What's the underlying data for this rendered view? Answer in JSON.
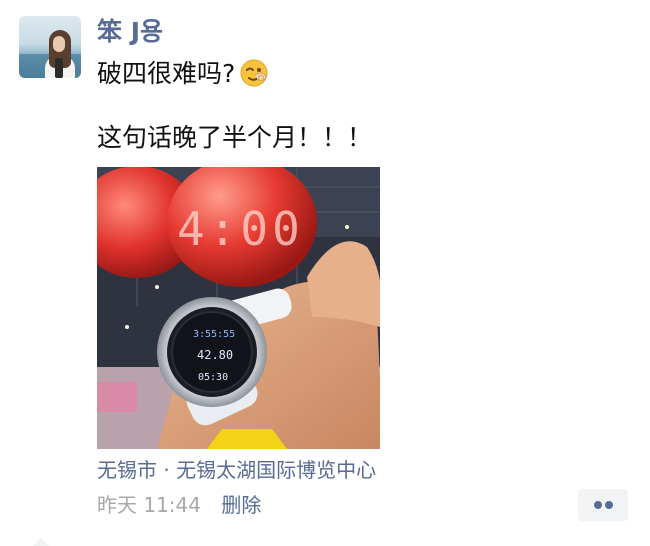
{
  "post": {
    "username": "笨 J용",
    "text_line1": "破四很难吗?",
    "emoji": "wink-face-emoji",
    "text_line2": "这句话晚了半个月！！！",
    "location": "无锡市 · 无锡太湖国际博览中心",
    "timestamp": "昨天 11:44",
    "delete_label": "删除"
  },
  "photo": {
    "balloon_text": "4:00",
    "watch_readouts": [
      "3:55:55",
      "42.80",
      "05:30"
    ]
  },
  "colors": {
    "link": "#576b95",
    "text": "#111111",
    "muted": "#a8a8a8",
    "more_button_bg": "#f2f3f5"
  }
}
